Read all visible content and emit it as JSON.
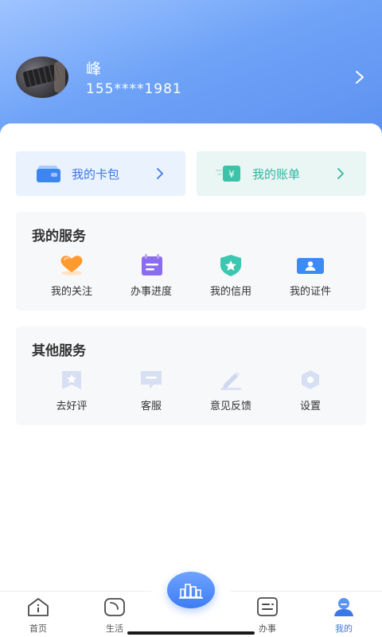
{
  "profile": {
    "name": "峰",
    "phone": "155****1981"
  },
  "quick_cards": [
    {
      "label": "我的卡包",
      "icon": "wallet-icon"
    },
    {
      "label": "我的账单",
      "icon": "bill-icon"
    }
  ],
  "my_services": {
    "title": "我的服务",
    "items": [
      {
        "label": "我的关注",
        "icon": "heart-icon"
      },
      {
        "label": "办事进度",
        "icon": "calendar-progress-icon"
      },
      {
        "label": "我的信用",
        "icon": "shield-star-icon"
      },
      {
        "label": "我的证件",
        "icon": "id-card-icon"
      }
    ]
  },
  "other_services": {
    "title": "其他服务",
    "items": [
      {
        "label": "去好评",
        "icon": "star-bookmark-icon"
      },
      {
        "label": "客服",
        "icon": "chat-bubble-icon"
      },
      {
        "label": "意见反馈",
        "icon": "pencil-icon"
      },
      {
        "label": "设置",
        "icon": "gear-hexagon-icon"
      }
    ]
  },
  "tabbar": {
    "items": [
      {
        "label": "首页",
        "icon": "home-icon",
        "active": false
      },
      {
        "label": "生活",
        "icon": "life-icon",
        "active": false
      },
      {
        "label": "",
        "icon": "city-buildings-icon",
        "active": false
      },
      {
        "label": "办事",
        "icon": "task-list-icon",
        "active": false
      },
      {
        "label": "我的",
        "icon": "user-icon",
        "active": true
      }
    ]
  },
  "colors": {
    "brand": "#3b78e7",
    "teal": "#33b59f",
    "header_top": "#9fc4ff",
    "header_bottom": "#5b8ff0"
  }
}
